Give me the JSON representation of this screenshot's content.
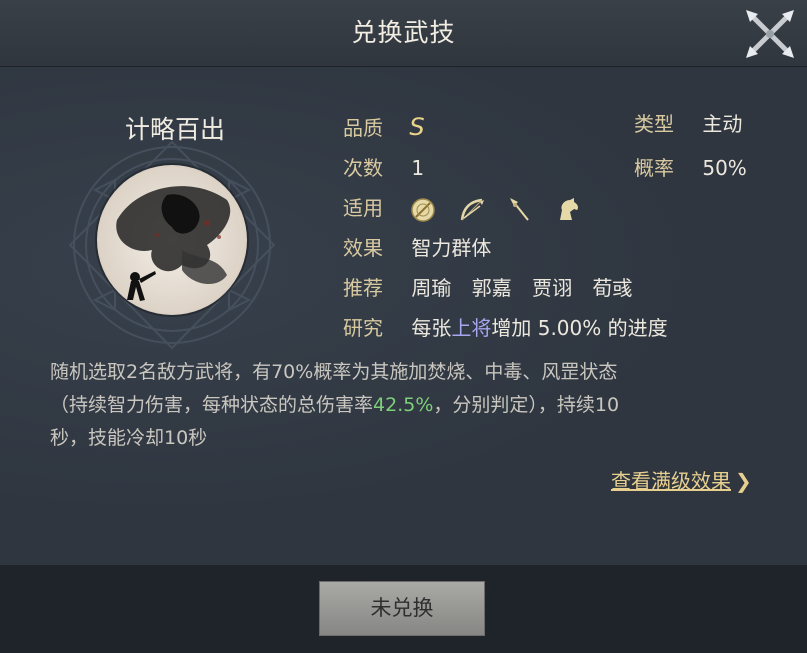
{
  "header": {
    "title": "兑换武技"
  },
  "skill": {
    "name": "计略百出",
    "portrait_icon": "ink-battle-portrait"
  },
  "stats": {
    "quality_label": "品质",
    "quality_value": "S",
    "type_label": "类型",
    "type_value": "主动",
    "count_label": "次数",
    "count_value": "1",
    "rate_label": "概率",
    "rate_value": "50%",
    "apply_label": "适用",
    "apply_icons": [
      "shield-icon",
      "bow-icon",
      "spear-icon",
      "horse-icon"
    ],
    "effect_label": "效果",
    "effect_value": "智力群体",
    "recommend_label": "推荐",
    "recommend": [
      "周瑜",
      "郭嘉",
      "贾诩",
      "荀彧"
    ],
    "research_label": "研究",
    "research_pre": "每张",
    "research_hl": "上将",
    "research_post": "增加 5.00% 的进度"
  },
  "description": {
    "line1": "随机选取2名敌方武将，有70%概率为其施加焚烧、中毒、风罡状态",
    "line2_pre": "（持续智力伤害，每种状态的总伤害率",
    "line2_hl": "42.5%",
    "line2_post": "，分别判定），持续10",
    "line3": "秒，技能冷却10秒"
  },
  "full_effect_link": "查看满级效果",
  "button": {
    "label": "未兑换"
  },
  "colors": {
    "gold": "#d8c9a0",
    "blue_highlight": "#a7a6f0",
    "green_highlight": "#7ed07a"
  }
}
